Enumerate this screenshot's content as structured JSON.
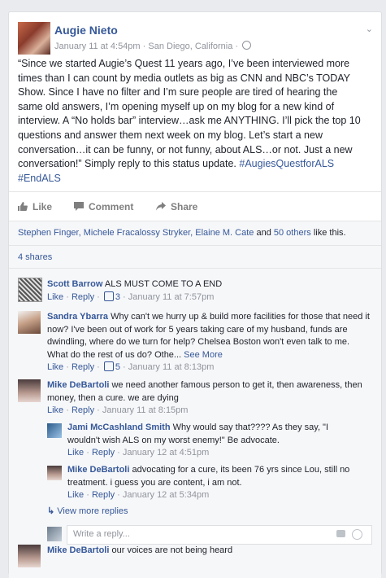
{
  "post": {
    "author": "Augie Nieto",
    "date": "January 11 at 4:54pm",
    "location": "San Diego, California",
    "text_lines": [
      "“Since we started Augie’s Quest 11 years ago, I’ve been interviewed more",
      "times than I can count by media outlets as big as CNN and NBC’s TODAY",
      "Show. Since I have no filter and I’m sure people are tired of hearing the",
      "same old answers, I’m opening myself up on my blog for a new kind of",
      "interview. A “No holds bar” interview…ask me ANYTHING. I’ll pick the top 10",
      "questions and answer them next week on my blog. Let’s start a new",
      "conversation…it can be funny, or not funny, about ALS…or not. Just a new",
      "conversation!” Simply reply to this status update."
    ],
    "hashtag1": "#AugiesQuestforALS",
    "hashtag2": "#EndALS"
  },
  "actions": {
    "like": "Like",
    "comment": "Comment",
    "share": "Share"
  },
  "likes": {
    "names": "Stephen Finger, Michele Fracalossy Stryker, Elaine M. Cate",
    "and": "and",
    "others": "50 others",
    "suffix": "like this."
  },
  "shares": "4 shares",
  "comments": [
    {
      "name": "Scott Barrow",
      "text": "ALS MUST COME TO A END",
      "like": "Like",
      "reply": "Reply",
      "likes": "3",
      "date": "January 11 at 7:57pm"
    },
    {
      "name": "Sandra Ybarra",
      "text_lines": [
        "Why can't we hurry up & build more facilities for those that need it",
        "now? I've been out of work for 5 years taking care of my husband, funds are",
        "dwindling, where do we turn for help? Chelsea Boston won't even talk to me.",
        "What do the rest of us do? Othe..."
      ],
      "see_more": "See More",
      "like": "Like",
      "reply": "Reply",
      "likes": "5",
      "date": "January 11 at 8:13pm"
    },
    {
      "name": "Mike DeBartoli",
      "text_lines": [
        "we need another famous person to get it, then awareness, then",
        "money, then a cure. we are dying"
      ],
      "like": "Like",
      "reply": "Reply",
      "date": "January 11 at 8:15pm"
    },
    {
      "name": "Jami McCashland Smith",
      "text_lines": [
        "Why would say that???? As they say, \"I",
        "wouldn't wish ALS on my worst enemy!\" Be advocate."
      ],
      "like": "Like",
      "reply": "Reply",
      "date": "January 12 at 4:51pm"
    },
    {
      "name": "Mike DeBartoli",
      "text_lines": [
        "advocating for a cure, its been 76 yrs since Lou, still no",
        "treatment. i guess you are content, i am not."
      ],
      "like": "Like",
      "reply": "Reply",
      "date": "January 12 at 5:34pm"
    },
    {
      "name": "Mike DeBartoli",
      "text": "our voices are not being heard"
    }
  ],
  "view_more": "View more replies",
  "reply_placeholder": "Write a reply...",
  "icons": {
    "chevron": "chevron-down-icon",
    "globe": "globe-icon",
    "like": "thumbs-up-icon",
    "comment": "comment-icon",
    "share": "share-arrow-icon",
    "camera": "camera-icon",
    "emoji": "emoji-icon"
  },
  "colors": {
    "link": "#365899",
    "meta": "#90949c",
    "bg": "#e9ebee",
    "panel": "#f6f7f9"
  }
}
